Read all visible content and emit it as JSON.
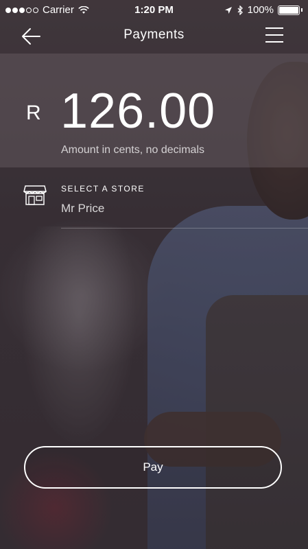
{
  "status_bar": {
    "carrier": "Carrier",
    "time": "1:20 PM",
    "battery": "100%",
    "signal_icon": "signal-dots-icon",
    "wifi_icon": "wifi-icon",
    "location_icon": "location-arrow-icon",
    "bluetooth_icon": "bluetooth-icon",
    "battery_icon": "battery-icon"
  },
  "nav": {
    "title": "Payments",
    "back_icon": "back-arrow-icon",
    "menu_icon": "hamburger-menu-icon"
  },
  "amount": {
    "currency": "R",
    "value": "126.00",
    "hint": "Amount in cents, no decimals"
  },
  "store": {
    "icon": "storefront-icon",
    "label": "SELECT A STORE",
    "value": "Mr Price"
  },
  "pay_button": {
    "label": "Pay"
  },
  "colors": {
    "text": "#ffffff",
    "panel": "#786e74",
    "background": "#3f373d"
  }
}
